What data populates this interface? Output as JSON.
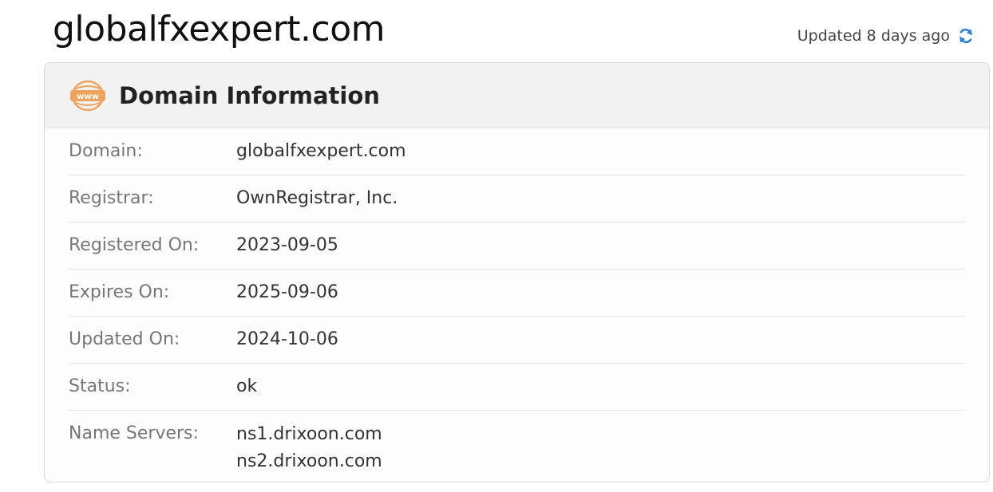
{
  "page": {
    "title": "globalfxexpert.com",
    "updated_text": "Updated 8 days ago",
    "refresh_icon": "refresh-icon"
  },
  "card": {
    "icon": "www-icon",
    "icon_text": "www",
    "heading": "Domain Information",
    "rows": [
      {
        "label": "Domain:",
        "value": "globalfxexpert.com"
      },
      {
        "label": "Registrar:",
        "value": "OwnRegistrar, Inc."
      },
      {
        "label": "Registered On:",
        "value": "2023-09-05"
      },
      {
        "label": "Expires On:",
        "value": "2025-09-06"
      },
      {
        "label": "Updated On:",
        "value": "2024-10-06"
      },
      {
        "label": "Status:",
        "value": "ok"
      }
    ],
    "name_servers": {
      "label": "Name Servers:",
      "values": [
        "ns1.drixoon.com",
        "ns2.drixoon.com"
      ]
    }
  },
  "colors": {
    "accent_orange": "#f0a35e",
    "refresh_blue": "#2d7ed6"
  }
}
